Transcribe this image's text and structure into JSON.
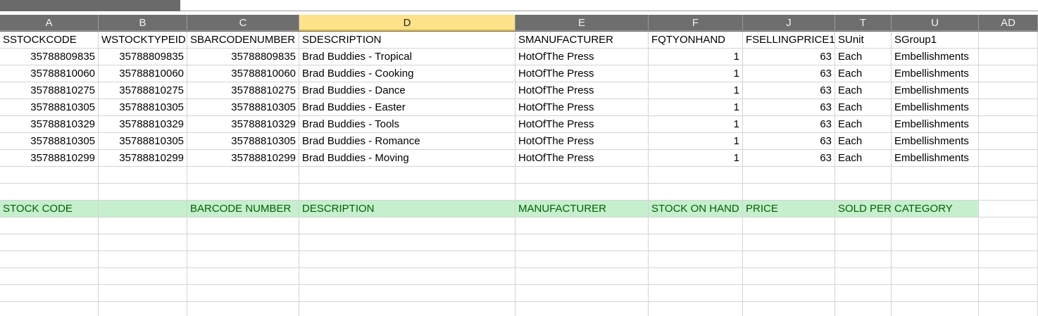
{
  "columns": [
    "A",
    "B",
    "C",
    "D",
    "E",
    "F",
    "J",
    "T",
    "U",
    "AD"
  ],
  "selected_column": "D",
  "header_row": [
    "SSTOCKCODE",
    "WSTOCKTYPEID",
    "SBARCODENUMBER",
    "SDESCRIPTION",
    "SMANUFACTURER",
    "FQTYONHAND",
    "FSELLINGPRICE1",
    "SUnit",
    "SGroup1",
    ""
  ],
  "data_rows": [
    [
      "35788809835",
      "35788809835",
      "35788809835",
      "Brad Buddies - Tropical",
      "HotOfThe Press",
      "1",
      "63",
      "Each",
      "Embellishments",
      ""
    ],
    [
      "35788810060",
      "35788810060",
      "35788810060",
      "Brad Buddies - Cooking",
      "HotOfThe Press",
      "1",
      "63",
      "Each",
      "Embellishments",
      ""
    ],
    [
      "35788810275",
      "35788810275",
      "35788810275",
      "Brad Buddies - Dance",
      "HotOfThe Press",
      "1",
      "63",
      "Each",
      "Embellishments",
      ""
    ],
    [
      "35788810305",
      "35788810305",
      "35788810305",
      "Brad Buddies - Easter",
      "HotOfThe Press",
      "1",
      "63",
      "Each",
      "Embellishments",
      ""
    ],
    [
      "35788810329",
      "35788810329",
      "35788810329",
      "Brad Buddies - Tools",
      "HotOfThe Press",
      "1",
      "63",
      "Each",
      "Embellishments",
      ""
    ],
    [
      "35788810305",
      "35788810305",
      "35788810305",
      "Brad Buddies - Romance",
      "HotOfThe Press",
      "1",
      "63",
      "Each",
      "Embellishments",
      ""
    ],
    [
      "35788810299",
      "35788810299",
      "35788810299",
      "Brad Buddies - Moving",
      "HotOfThe Press",
      "1",
      "63",
      "Each",
      "Embellishments",
      ""
    ]
  ],
  "mapping_row": [
    "STOCK CODE",
    "",
    "BARCODE NUMBER",
    "DESCRIPTION",
    "MANUFACTURER",
    "STOCK ON HAND",
    "PRICE",
    "SOLD PER",
    "CATEGORY",
    ""
  ],
  "colors": {
    "highlight_fill": "#c6efce",
    "highlight_text": "#006100",
    "selected_header": "#ffe28a",
    "header_bg": "#6e6e6e"
  }
}
